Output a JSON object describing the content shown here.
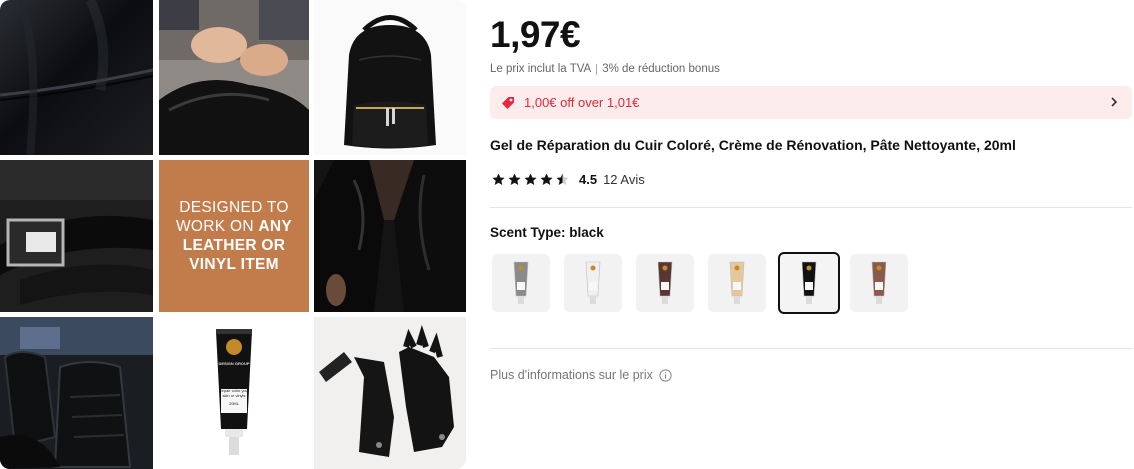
{
  "gallery": {
    "promo": {
      "line1": "DESIGNED TO",
      "line2_light": "WORK ON ",
      "line2_bold": "ANY",
      "line3": "LEATHER OR",
      "line4": "VINYL ITEM"
    },
    "tube_label": {
      "brand": "DESIGN GROUP",
      "line1": "Repair color your",
      "line2": "skin or vinyls",
      "size": "20ML"
    }
  },
  "product": {
    "price": "1,97€",
    "tax_note": "Le prix inclut la TVA",
    "bonus_note": "3% de réduction bonus",
    "coupon_text": "1,00€ off over 1,01€",
    "title": "Gel de Réparation du Cuir Coloré, Crème de Rénovation, Pâte Nettoyante, 20ml",
    "rating": "4.5",
    "rating_fraction": 0.9,
    "reviews": "12 Avis",
    "scent_label": "Scent Type:",
    "scent_value": "black",
    "more_info": "Plus d'informations sur le prix"
  },
  "swatches": [
    {
      "name": "grey",
      "color": "#8a8a8a",
      "selected": false
    },
    {
      "name": "white",
      "color": "#f0f0f0",
      "selected": false
    },
    {
      "name": "dark-brown",
      "color": "#5a3630",
      "selected": false
    },
    {
      "name": "beige",
      "color": "#e6c79a",
      "selected": false
    },
    {
      "name": "black",
      "color": "#111111",
      "selected": true
    },
    {
      "name": "brown",
      "color": "#8a5a4a",
      "selected": false
    }
  ],
  "colors": {
    "coupon_bg": "#fdecec",
    "coupon_text": "#e5283d",
    "promo_bg": "#c27b4b"
  }
}
